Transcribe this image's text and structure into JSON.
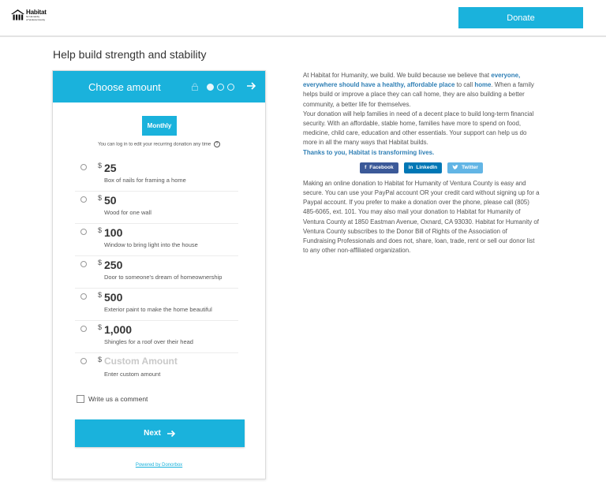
{
  "header": {
    "logo": {
      "title": "Habitat",
      "subtitle_line1": "for Humanity",
      "subtitle_line2": "of Ventura County"
    },
    "donate_label": "Donate"
  },
  "page_title": "Help build strength and stability",
  "form": {
    "title": "Choose amount",
    "step_current": 1,
    "step_total": 3,
    "frequency_label": "Monthly",
    "login_note": "You can log in to edit your recurring donation any time",
    "currency": "$",
    "amounts": [
      {
        "amount": "25",
        "desc": "Box of nails for framing a home"
      },
      {
        "amount": "50",
        "desc": "Wood for one wall"
      },
      {
        "amount": "100",
        "desc": "Window to bring light into the house"
      },
      {
        "amount": "250",
        "desc": "Door to someone's dream of homeownership"
      },
      {
        "amount": "500",
        "desc": "Exterior paint to make the home beautiful"
      },
      {
        "amount": "1,000",
        "desc": "Shingles for a roof over their head"
      }
    ],
    "custom": {
      "placeholder": "Custom Amount",
      "desc": "Enter custom amount"
    },
    "comment_label": "Write us a comment",
    "next_label": "Next",
    "powered_by": "Powered by Donorbox"
  },
  "info": {
    "p1_a": "At Habitat for Humanity, we build. We build because we believe that ",
    "p1_hl1": "everyone, everywhere should have a healthy, affordable place",
    "p1_b": " to call ",
    "p1_hl2": "home",
    "p1_c": ". When a family helps build or improve a place they can call home, they are also building a better community, a better life for themselves.",
    "p2": "Your donation will help families in need of a decent place to build long-term financial security. With an affordable, stable home, families have more to spend on food, medicine, child care, education and other essentials. Your support can help us do more in all the many ways that Habitat builds.",
    "thanks": "Thanks to you, Habitat is transforming lives.",
    "p3": "Making an online donation to Habitat for Humanity of Ventura County is easy and secure. You can use your PayPal account OR your credit card without signing up for a Paypal account. If you prefer to make a donation over the phone, please call (805) 485-6065, ext. 101. You may also mail your donation to Habitat for Humanity of Ventura County at 1850 Eastman Avenue, Oxnard, CA 93030. Habitat for Humanity of Ventura County subscribes to the Donor Bill of Rights of the Association of Fundraising Professionals and does not, share, loan, trade, rent or sell our donor list to any other non-affiliated organization."
  },
  "social": {
    "facebook": {
      "icon": "f",
      "label": "Facebook"
    },
    "linkedin": {
      "icon": "in",
      "label": "LinkedIn"
    },
    "twitter": {
      "icon": "twitter-bird-icon",
      "label": "Twitter"
    }
  },
  "colors": {
    "accent": "#1ab2dc",
    "link": "#2f7fb5",
    "facebook": "#3b5998",
    "linkedin": "#0077b5",
    "twitter": "#62b5e5"
  }
}
